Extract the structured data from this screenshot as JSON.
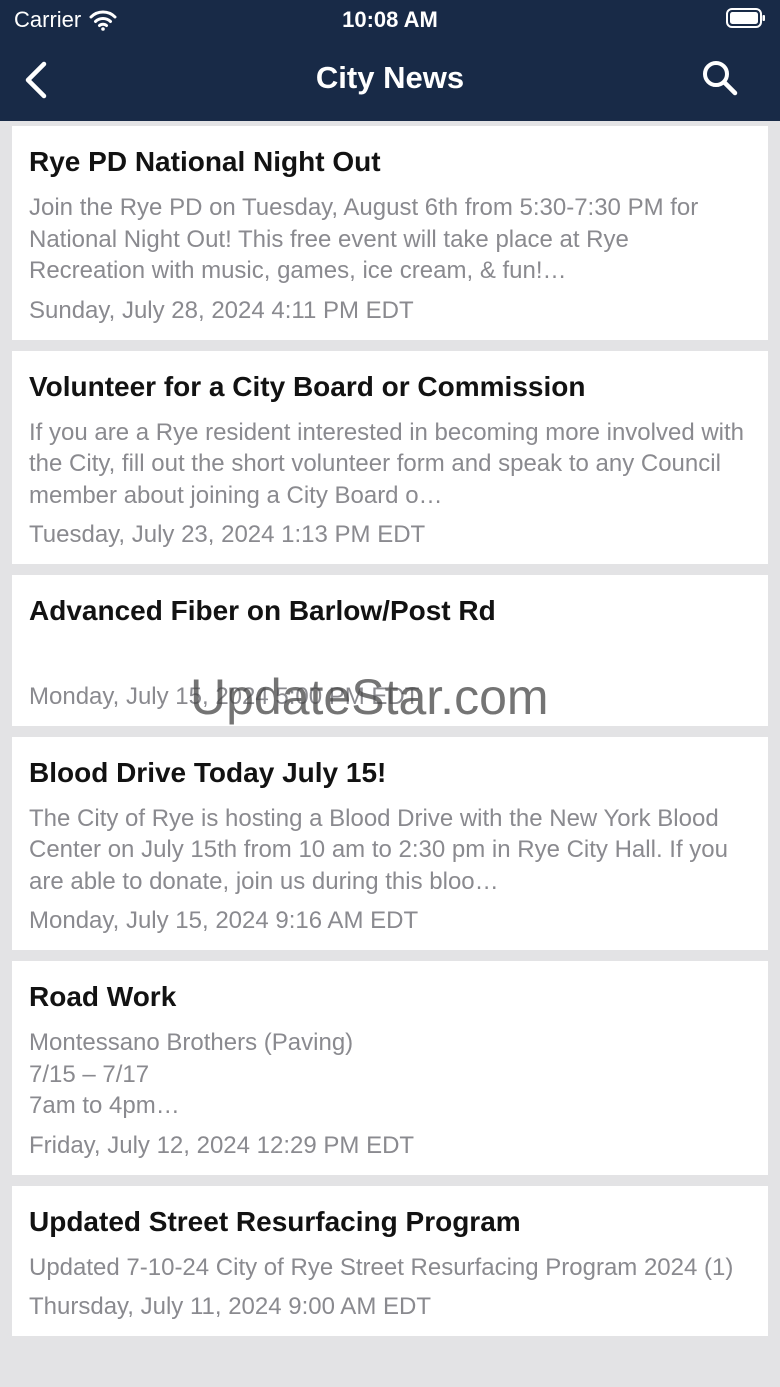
{
  "status_bar": {
    "carrier": "Carrier",
    "time": "10:08 AM"
  },
  "nav": {
    "title": "City News",
    "back_icon": "chevron-left-icon",
    "search_icon": "search-icon"
  },
  "colors": {
    "nav_background": "#182a47",
    "page_background": "#e3e3e5",
    "card_background": "#ffffff",
    "title_text": "#121212",
    "secondary_text": "#8a8a8f"
  },
  "news": [
    {
      "title": "Rye PD National Night Out",
      "summary": "Join the Rye PD on Tuesday, August 6th from 5:30-7:30 PM for National Night Out! This free event will take place at Rye Recreation with music, games, ice cream, & fun!…",
      "date": "Sunday, July 28, 2024 4:11 PM EDT"
    },
    {
      "title": "Volunteer for a City Board or Commission",
      "summary": "If you are a Rye resident interested in becoming more involved with the City, fill out the short volunteer form and speak to any Council member about joining a City Board o…",
      "date": "Tuesday, July 23, 2024 1:13 PM EDT"
    },
    {
      "title": "Advanced Fiber on Barlow/Post Rd",
      "summary": "",
      "date": "Monday, July 15, 2024 5:00 PM EDT"
    },
    {
      "title": "Blood Drive Today July 15!",
      "summary": "The City of Rye is hosting a Blood Drive with the New York Blood Center on July 15th from 10 am to 2:30 pm in Rye City Hall. If you are able to donate, join us during this bloo…",
      "date": "Monday, July 15, 2024 9:16 AM EDT"
    },
    {
      "title": "Road Work",
      "summary": "Montessano Brothers (Paving)\n7/15 – 7/17\n7am to 4pm…",
      "date": "Friday, July 12, 2024 12:29 PM EDT"
    },
    {
      "title": "Updated Street Resurfacing Program",
      "summary": "Updated 7-10-24 City of Rye Street Resurfacing Program 2024 (1)",
      "date": "Thursday, July 11, 2024 9:00 AM EDT"
    }
  ],
  "watermark": "UpdateStar.com"
}
